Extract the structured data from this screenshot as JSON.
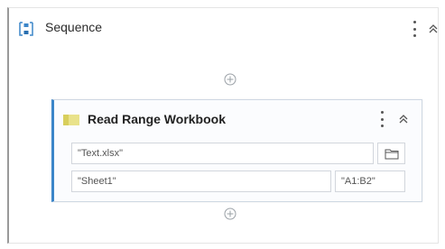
{
  "sequence": {
    "title": "Sequence",
    "icon": "sequence-icon"
  },
  "activity": {
    "title": "Read Range Workbook",
    "icon": "excel-icon",
    "accent_color": "#3c86c9",
    "workbook_path": "\"Text.xlsx\"",
    "sheet_name": "\"Sheet1\"",
    "range": "\"A1:B2\"",
    "browse_icon": "folder-icon"
  }
}
